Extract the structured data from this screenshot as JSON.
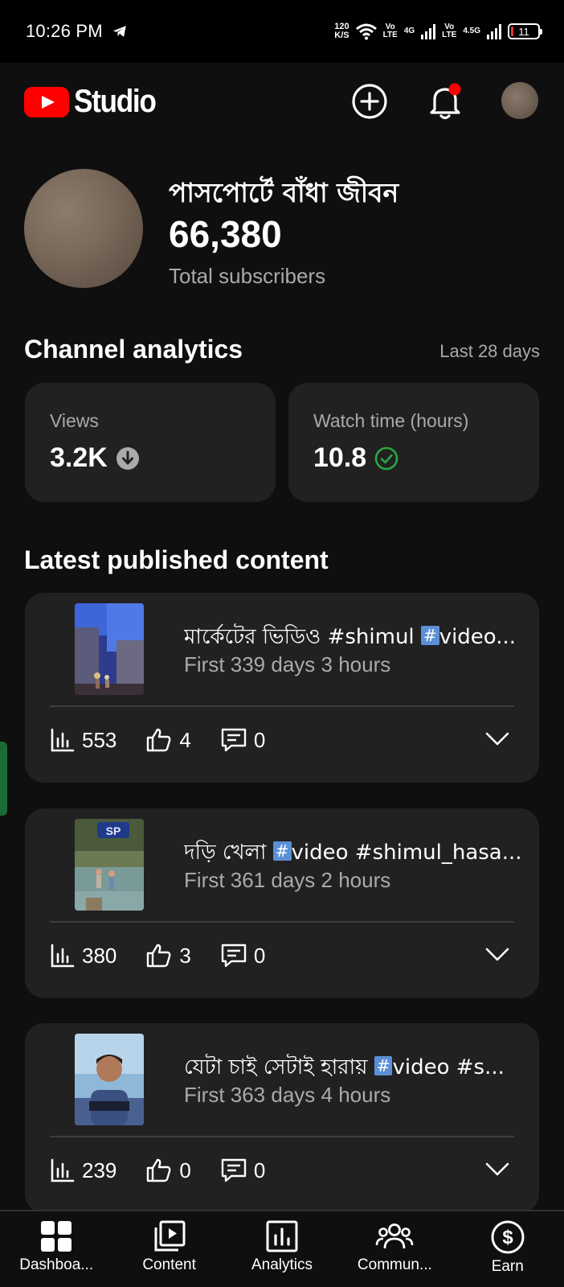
{
  "status_bar": {
    "time": "10:26 PM",
    "speed_value": "120",
    "speed_unit": "K/S",
    "net1_top": "Vo",
    "net1_bottom": "LTE",
    "net2": "4G",
    "net3_top": "Vo",
    "net3_bottom": "LTE",
    "net4": "4.5G",
    "battery": "11"
  },
  "header": {
    "logo_text": "Studio"
  },
  "channel": {
    "name": "পাসপোর্টে বাঁধা জীবন",
    "subscribers": "66,380",
    "subscribers_label": "Total subscribers"
  },
  "analytics": {
    "title": "Channel analytics",
    "period": "Last 28 days",
    "metrics": [
      {
        "label": "Views",
        "value": "3.2K",
        "status_icon": "down-arrow-icon"
      },
      {
        "label": "Watch time (hours)",
        "value": "10.8",
        "status_icon": "check-circle-icon"
      }
    ]
  },
  "latest": {
    "title": "Latest published content",
    "items": [
      {
        "title_pre": "মার্কেটের ভিডিও #shimul ",
        "title_post": "video...",
        "subtitle": "First 339 days 3 hours",
        "views": "553",
        "likes": "4",
        "comments": "0"
      },
      {
        "title_pre": "দড়ি খেলা ",
        "title_post": "video #shimul_hasa...",
        "subtitle": "First 361 days 2 hours",
        "views": "380",
        "likes": "3",
        "comments": "0"
      },
      {
        "title_pre": "যেটা চাই সেটাই হারায় ",
        "title_post": "video #s...",
        "subtitle": "First 363 days 4 hours",
        "views": "239",
        "likes": "0",
        "comments": "0"
      }
    ]
  },
  "bottom_nav": [
    {
      "label": "Dashboa...",
      "icon": "dashboard-icon"
    },
    {
      "label": "Content",
      "icon": "content-icon"
    },
    {
      "label": "Analytics",
      "icon": "analytics-icon"
    },
    {
      "label": "Commun...",
      "icon": "community-icon"
    },
    {
      "label": "Earn",
      "icon": "earn-icon"
    }
  ],
  "colors": {
    "background": "#0f0f0f",
    "card": "#212121",
    "brand_red": "#ff0000",
    "success_green": "#2ba640",
    "secondary_text": "#aaaaaa"
  }
}
